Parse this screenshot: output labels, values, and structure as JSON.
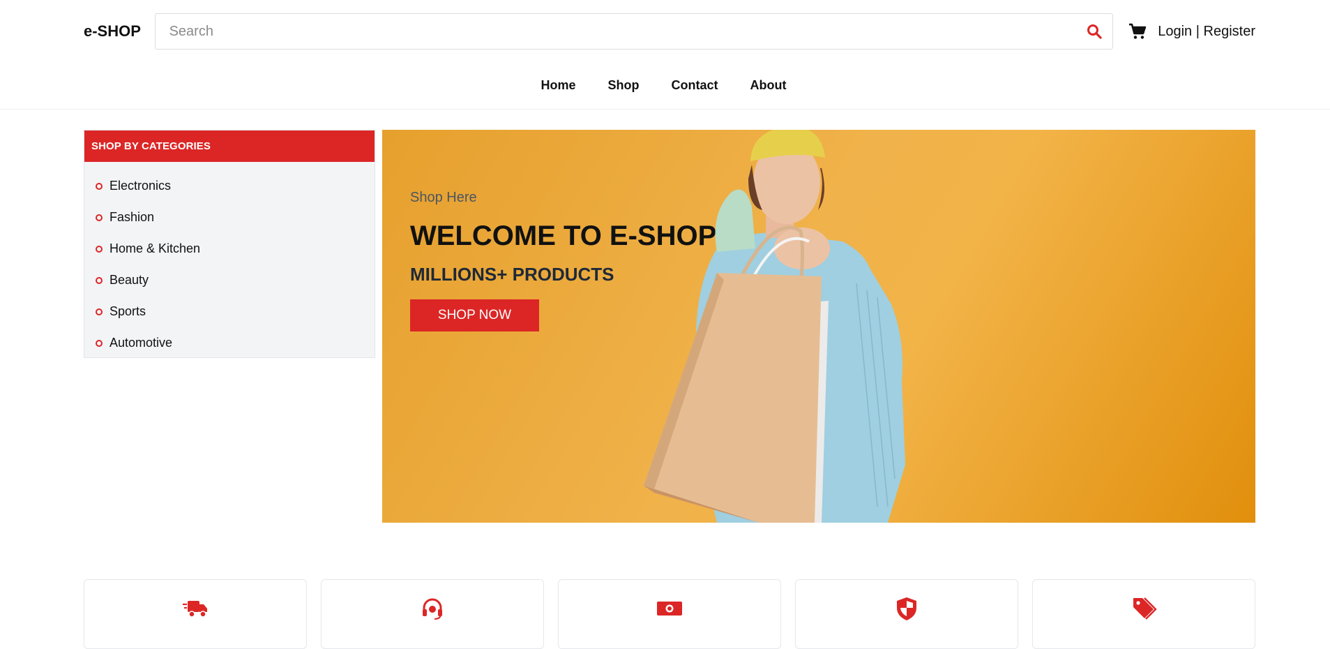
{
  "header": {
    "logo": "e-SHOP",
    "search_placeholder": "Search",
    "login": "Login",
    "separator": "|",
    "register": "Register"
  },
  "nav": [
    "Home",
    "Shop",
    "Contact",
    "About"
  ],
  "sidebar": {
    "title": "SHOP BY CATEGORIES",
    "items": [
      {
        "label": "Electronics"
      },
      {
        "label": "Fashion"
      },
      {
        "label": "Home & Kitchen"
      },
      {
        "label": "Beauty"
      },
      {
        "label": "Sports"
      },
      {
        "label": "Automotive"
      }
    ]
  },
  "hero": {
    "subtitle": "Shop Here",
    "title": "WELCOME TO E-SHOP",
    "tagline": "MILLIONS+ PRODUCTS",
    "button": "SHOP NOW"
  },
  "features": [
    {
      "icon": "truck-fast-icon"
    },
    {
      "icon": "headset-icon"
    },
    {
      "icon": "money-bill-icon"
    },
    {
      "icon": "shield-icon"
    },
    {
      "icon": "tags-icon"
    }
  ],
  "colors": {
    "accent": "#dc2626",
    "hero_bg": "#f0b24a",
    "sidebar_bg": "#f3f4f6"
  }
}
